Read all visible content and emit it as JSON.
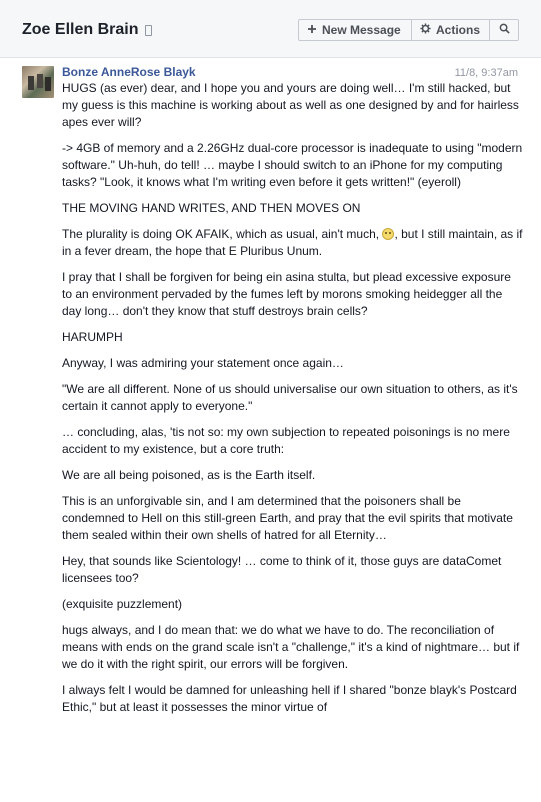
{
  "header": {
    "title": "Zoe Ellen Brain",
    "new_message_label": "New Message",
    "actions_label": "Actions"
  },
  "icons": {
    "mobile": "mobile-phone-icon",
    "plus": "plus-icon",
    "gear": "gear-icon",
    "search": "search-icon"
  },
  "message": {
    "sender": "Bonze AnneRose Blayk",
    "timestamp": "11/8, 9:37am",
    "paragraphs": [
      "HUGS (as ever) dear, and I hope you and yours are doing well… I'm still hacked, but my guess is this machine is working about as well as one designed by and for hairless apes ever will?",
      "-> 4GB of memory and a 2.26GHz dual-core processor is inadequate to using \"modern software.\"  Uh-huh, do tell!  … maybe I should switch to an iPhone for my computing tasks?  \"Look, it knows what I'm writing even before it gets written!\"  (eyeroll)",
      "THE MOVING HAND WRITES, AND THEN MOVES ON",
      "",
      "I pray that I shall be forgiven for being ein asina stulta, but plead excessive exposure to an environment pervaded by the fumes left by morons smoking heidegger all the day long… don't they know that stuff destroys brain cells?",
      "HARUMPH",
      "Anyway, I was admiring your statement once again…",
      "\"We are all different. None of us should universalise our own situation to others, as it's certain it cannot apply to everyone.\"",
      "… concluding, alas, 'tis not so:  my own subjection to repeated poisonings is no mere accident to my existence, but a core truth:",
      "We are all being poisoned, as is the Earth itself.",
      "This is an unforgivable sin, and I am determined that the poisoners shall be condemned to Hell on this still-green Earth, and pray that the evil spirits that motivate them sealed within their own shells of hatred for all Eternity…",
      "Hey, that sounds like Scientology!  … come to think of it, those guys are dataComet licensees too?",
      "(exquisite puzzlement)",
      "hugs always, and I do mean that:  we do what we have to do.  The reconciliation of means with ends on the grand scale isn't a \"challenge,\" it's a kind of nightmare… but if we do it with the right spirit, our errors will be forgiven.",
      "I always felt I would be damned for unleashing hell if I shared \"bonze blayk's Postcard Ethic,\" but at least it possesses the minor virtue of"
    ],
    "plurality_before": "The plurality is doing OK AFAIK, which as usual, ain't much, ",
    "plurality_after": ", but I still maintain, as if in a fever dream, the hope that E Pluribus Unum."
  }
}
